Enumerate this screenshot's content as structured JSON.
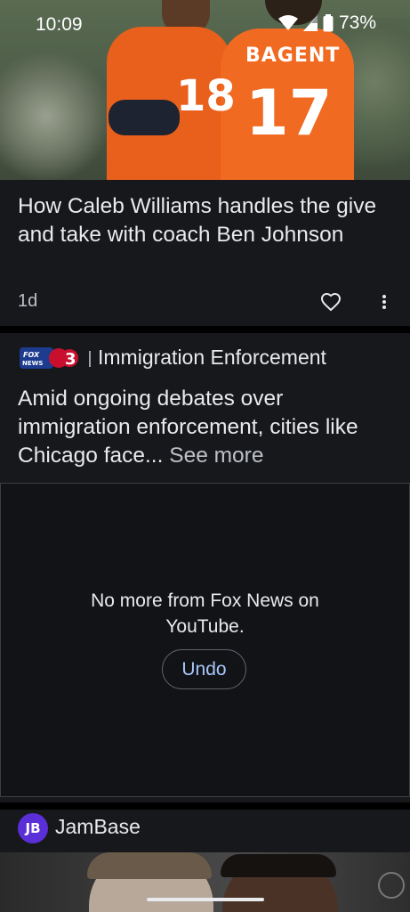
{
  "status_bar": {
    "time": "10:09",
    "battery": "73%"
  },
  "cards": [
    {
      "title": "How Caleb Williams handles the give and take with coach Ben Johnson",
      "age": "1d",
      "image_text": {
        "jersey_name": "BAGENT",
        "numbers": [
          "18",
          "17"
        ]
      }
    },
    {
      "source_logo": "FOX NEWS 3",
      "topic": "Immigration Enforcement",
      "title": "Amid ongoing debates over immigration enforcement, cities like Chicago face...",
      "see_more": "See more",
      "hidden_message": "No more from Fox News on YouTube.",
      "undo_label": "Undo"
    },
    {
      "source_logo": "JB",
      "source": "JamBase"
    }
  ],
  "colors": {
    "card_bg": "#17181c",
    "accent_link": "#a8c7fa",
    "jambase_brand": "#5b2fd8",
    "jersey_orange": "#e8601c"
  }
}
